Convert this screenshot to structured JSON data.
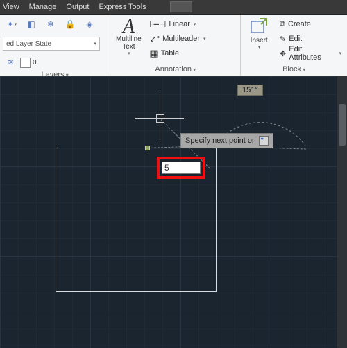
{
  "menu": {
    "view": "View",
    "manage": "Manage",
    "output": "Output",
    "express": "Express Tools"
  },
  "layers": {
    "state_label": "ed Layer State",
    "panel_title": "Layers",
    "current_layer": "0"
  },
  "annotation": {
    "mtext": "Multiline Text",
    "linear": "Linear",
    "mleader": "Multileader",
    "table": "Table",
    "panel_title": "Annotation"
  },
  "block": {
    "insert": "Insert",
    "create": "Create",
    "edit": "Edit",
    "attr": "Edit Attributes",
    "panel_title": "Block"
  },
  "canvas": {
    "prompt": "Specify next point or",
    "angle": "151°",
    "input_value": "5"
  }
}
